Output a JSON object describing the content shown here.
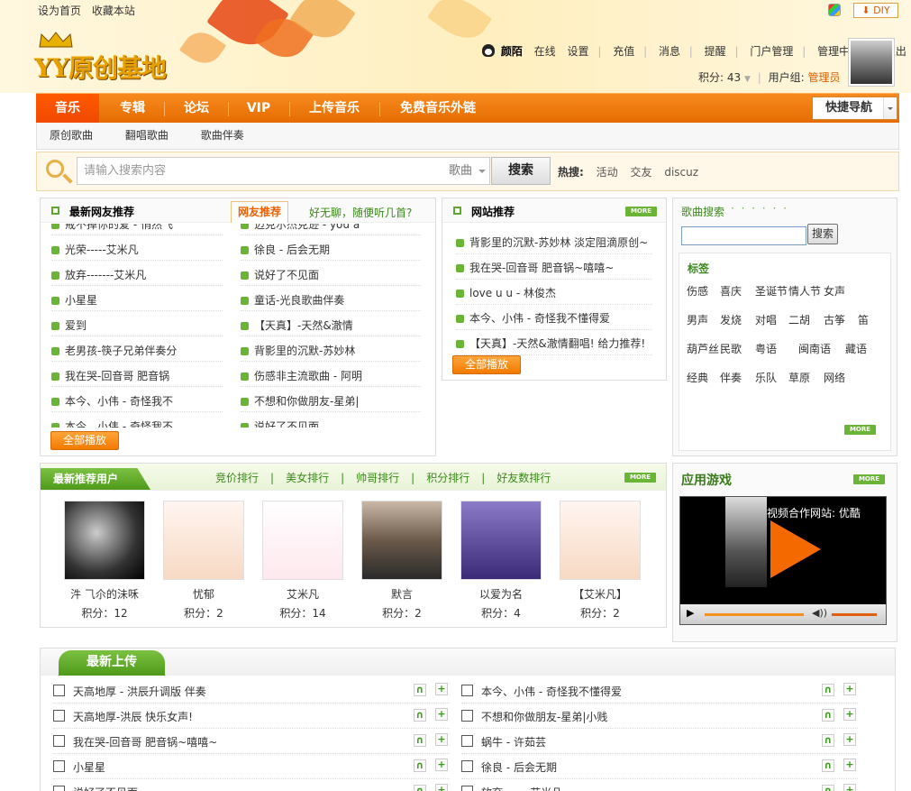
{
  "top": {
    "set_home": "设为首页",
    "bookmark": "收藏本站",
    "diy": "DIY"
  },
  "logo": {
    "text": "YY原创基地"
  },
  "user": {
    "name": "颜陌",
    "status": "在线",
    "settings": "设置",
    "recharge": "充值",
    "messages": "消息",
    "remind": "提醒",
    "portal_admin": "门户管理",
    "admin_center": "管理中心",
    "logout": "退出",
    "points_label": "积分: 43",
    "group_label": "用户组:",
    "group": "管理员"
  },
  "nav": {
    "items": [
      "音乐",
      "专辑",
      "论坛",
      "VIP",
      "上传音乐",
      "免费音乐外链"
    ],
    "quick": "快捷导航"
  },
  "subnav": [
    "原创歌曲",
    "翻唱歌曲",
    "歌曲伴奏"
  ],
  "search": {
    "placeholder": "请输入搜索内容",
    "category": "歌曲",
    "button": "搜索",
    "hot_label": "热搜:",
    "hot": [
      "活动",
      "交友",
      "discuz"
    ]
  },
  "friends_panel": {
    "title": "最新网友推荐",
    "tab": "网友推荐",
    "tagline": "好无聊，随便听几首?",
    "play_all": "全部播放",
    "col1": [
      "戒不掉你的爱 - 悄然飞",
      "光荣-----艾米凡",
      "放弃-------艾米凡",
      "小星星",
      "爱到",
      "老男孩-筷子兄弟伴奏分",
      "我在哭-回音哥 肥音锅",
      "本今、小伟 - 奇怪我不",
      "本今、小伟 - 奇怪我不"
    ],
    "col2": [
      "迈克尔杰克逊 - you a",
      "徐良 - 后会无期",
      "说好了不见面",
      "童话-光良歌曲伴奏",
      "【天真】-天然&澈情",
      "背影里的沉默-苏妙林",
      "伤感非主流歌曲 - 阿明",
      "不想和你做朋友-星弟|",
      "说好了不见面"
    ]
  },
  "site_panel": {
    "title": "网站推荐",
    "more": "MORE",
    "play_all": "全部播放",
    "items": [
      "背影里的沉默-苏妙林 淡定阻滴原创~",
      "我在哭-回音哥 肥音锅~嘻嘻~",
      "love u u - 林俊杰",
      "本今、小伟 - 奇怪我不懂得爱",
      "【天真】-天然&澈情翻唱! 给力推荐!"
    ]
  },
  "song_search": {
    "title": "歌曲搜索",
    "button": "搜索",
    "tags_title": "标签",
    "tags": [
      "伤感",
      "喜庆",
      "圣诞节",
      "情人节",
      "女声",
      "男声",
      "发烧",
      "对唱",
      "二胡",
      "古筝",
      "笛",
      "葫芦丝",
      "民歌",
      "粤语",
      "闽南语",
      "藏语",
      "经典",
      "伴奏",
      "乐队",
      "草原",
      "网络"
    ],
    "more": "MORE"
  },
  "users_panel": {
    "title": "最新推荐用户",
    "more": "MORE",
    "links": [
      "竞价排行",
      "美女排行",
      "帅哥排行",
      "积分排行",
      "好友数排行"
    ],
    "users": [
      {
        "name": "汼 ⺄尒的沬咊",
        "score": "积分：12"
      },
      {
        "name": "忧郁",
        "score": "积分：2"
      },
      {
        "name": "艾米凡",
        "score": "积分：14"
      },
      {
        "name": "默言",
        "score": "积分：2"
      },
      {
        "name": "以爱为名",
        "score": "积分：4"
      },
      {
        "name": "【艾米凡】",
        "score": "积分：2"
      }
    ]
  },
  "game_panel": {
    "title": "应用游戏",
    "more": "MORE",
    "video_title": "视频合作网站: 优酷"
  },
  "latest": {
    "title": "最新上传",
    "left": [
      "天高地厚 - 洪辰升调版 伴奏",
      "天高地厚-洪辰 快乐女声!",
      "我在哭-回音哥 肥音锅~嘻嘻~",
      "小星星",
      "说好了不见面"
    ],
    "right": [
      "本今、小伟 - 奇怪我不懂得爱",
      "不想和你做朋友-星弟|小贱",
      "蜗牛 - 许茹芸",
      "徐良 - 后会无期",
      "放弃-------艾米凡"
    ]
  },
  "colors": {
    "nav": "#f07a10",
    "green": "#6bb536",
    "orange": "#e06000"
  }
}
